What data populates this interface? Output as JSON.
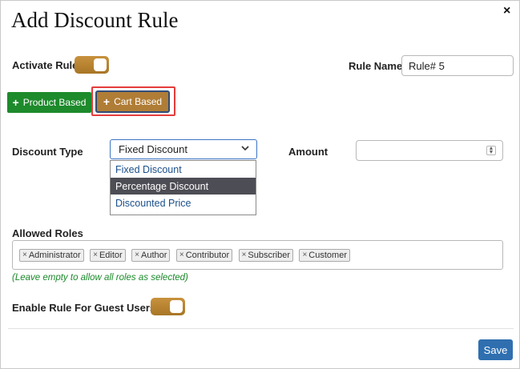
{
  "dialog": {
    "title": "Add Discount Rule",
    "close_icon": "×"
  },
  "activate_rule": {
    "label": "Activate Rule",
    "enabled": true
  },
  "rule_name": {
    "label": "Rule Name",
    "value": "Rule# 5"
  },
  "rule_type_buttons": [
    {
      "label": "Product Based",
      "icon": "plus-icon",
      "color": "#1d8a2b"
    },
    {
      "label": "Cart Based",
      "icon": "plus-icon",
      "color": "#b07d36",
      "highlighted": true
    }
  ],
  "discount_type": {
    "label": "Discount Type",
    "selected": "Fixed Discount",
    "options": [
      "Fixed Discount",
      "Percentage Discount",
      "Discounted Price"
    ],
    "hovered_option": "Percentage Discount"
  },
  "amount": {
    "label": "Amount",
    "value": ""
  },
  "allowed_roles": {
    "label": "Allowed Roles",
    "roles": [
      "Administrator",
      "Editor",
      "Author",
      "Contributor",
      "Subscriber",
      "Customer"
    ],
    "hint": "(Leave empty to allow all roles as selected)"
  },
  "guest_users": {
    "label": "Enable Rule For Guest Users?",
    "enabled": true
  },
  "footer": {
    "save_label": "Save"
  },
  "colors": {
    "accent_gold": "#b07d36",
    "product_green": "#1d8a2b",
    "save_blue": "#2f6fb0",
    "hint_green": "#1a8a2a"
  }
}
